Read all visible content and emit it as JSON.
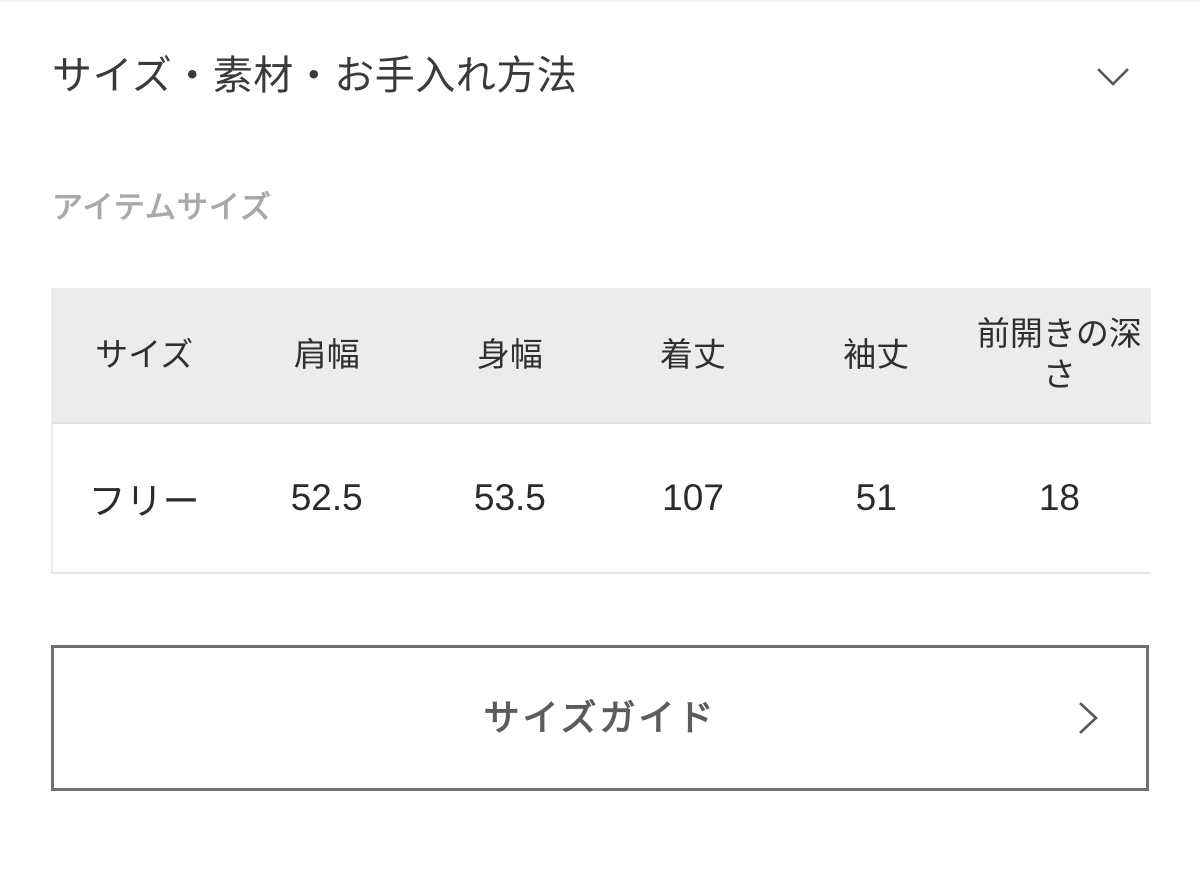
{
  "accordion": {
    "title": "サイズ・素材・お手入れ方法",
    "toggle_icon": "chevron-down-icon",
    "expanded": true
  },
  "section": {
    "label": "アイテムサイズ"
  },
  "size_table": {
    "columns": [
      "サイズ",
      "肩幅",
      "身幅",
      "着丈",
      "袖丈",
      "前開きの深さ"
    ],
    "rows": [
      {
        "size": "フリー",
        "shoulder_width": "52.5",
        "body_width": "53.5",
        "body_length": "107",
        "sleeve_length": "51",
        "front_opening_depth": "18"
      }
    ]
  },
  "size_guide_button": {
    "label": "サイズガイド",
    "arrow_icon": "chevron-right-icon"
  },
  "colors": {
    "page_background": "#ffffff",
    "title_text": "#3a3a3a",
    "section_label_text": "#a9a9a9",
    "table_header_background": "#ececec",
    "table_header_text": "#2f2f2f",
    "table_cell_text": "#2b2b2b",
    "table_border": "#e6e6e6",
    "button_border": "#6f6f6f",
    "button_label_text": "#5c5c5c",
    "icon": "#575757"
  }
}
